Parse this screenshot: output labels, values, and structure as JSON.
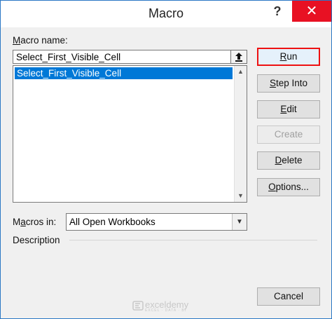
{
  "window": {
    "title": "Macro",
    "help_label": "?",
    "close_label": "✕"
  },
  "macro_name": {
    "label_hotkey": "M",
    "label_rest": "acro name:",
    "value": "Select_First_Visible_Cell"
  },
  "macro_list": {
    "items": [
      "Select_First_Visible_Cell"
    ],
    "selected_index": 0
  },
  "buttons": {
    "run": {
      "hotkey": "R",
      "rest": "un"
    },
    "step_into": {
      "hotkey": "S",
      "rest": "tep Into"
    },
    "edit": {
      "hotkey": "E",
      "rest": "dit"
    },
    "create": {
      "label": "Create",
      "enabled": false
    },
    "delete": {
      "hotkey": "D",
      "rest": "elete"
    },
    "options": {
      "hotkey": "O",
      "rest": "ptions..."
    },
    "cancel": {
      "label": "Cancel"
    }
  },
  "macros_in": {
    "label_pre": "M",
    "label_hotkey": "a",
    "label_rest": "cros in:",
    "selected": "All Open Workbooks"
  },
  "description": {
    "label": "Description"
  },
  "watermark": {
    "name": "exceldemy",
    "tagline": "EXCEL · DATA · BI"
  }
}
